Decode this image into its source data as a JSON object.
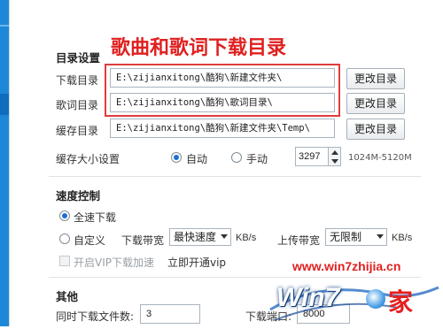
{
  "sections": {
    "directory": "目录设置",
    "speed": "速度控制",
    "other": "其他"
  },
  "annotation": "歌曲和歌词下载目录",
  "download_dir": {
    "label": "下载目录",
    "value": "E:\\zijianxitong\\酷狗\\新建文件夹\\",
    "button": "更改目录"
  },
  "lyrics_dir": {
    "label": "歌词目录",
    "value": "E:\\zijianxitong\\酷狗\\歌词目录\\",
    "button": "更改目录"
  },
  "cache_dir": {
    "label": "缓存目录",
    "value": "E:\\zijianxitong\\酷狗\\新建文件夹\\Temp\\",
    "button": "更改目录"
  },
  "cache_size": {
    "label": "缓存大小设置",
    "auto": "自动",
    "manual": "手动",
    "value": "3297",
    "range": "1024M-5120M",
    "selected": "auto"
  },
  "speed": {
    "full_speed": "全速下载",
    "custom": "自定义",
    "selected": "full_speed",
    "download_bw_label": "下载带宽",
    "download_bw_value": "最快速度",
    "upload_bw_label": "上传带宽",
    "upload_bw_value": "无限制",
    "unit": "KB/s",
    "vip_checkbox": "开启VIP下载加速",
    "vip_link": "立即开通vip"
  },
  "other": {
    "simultaneous_label": "同时下载文件数:",
    "simultaneous_value": "3",
    "port_label": "下载端口:",
    "port_value": "8000"
  },
  "watermark": {
    "url": "www.win7zhijia.cn",
    "brand": "Win7",
    "suffix": "家"
  },
  "colors": {
    "accent": "#1e88d8",
    "highlight_box": "#e03c3c",
    "radio_selected": "#1d6fd0"
  }
}
